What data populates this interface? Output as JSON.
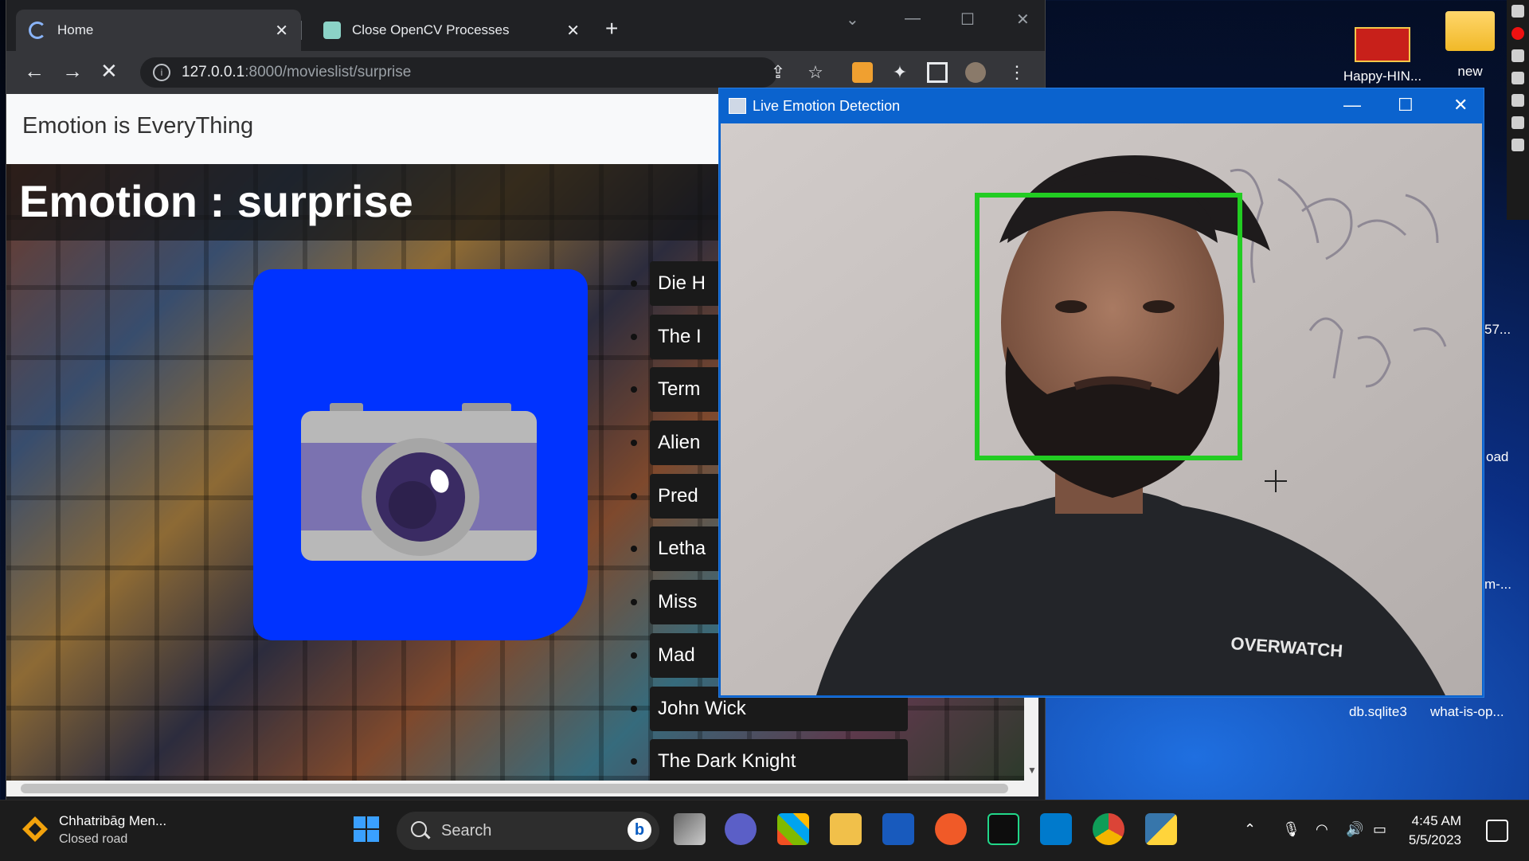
{
  "browser": {
    "tabs": [
      {
        "label": "Home"
      },
      {
        "label": "Close OpenCV Processes"
      }
    ],
    "url": {
      "host": "127.0.0.1",
      "path": ":8000/movieslist/surprise"
    }
  },
  "site": {
    "brand": "Emotion is EveryThing",
    "emotion_title": "Emotion : surprise",
    "movies": [
      "Die H",
      "The I",
      "Term",
      "Alien",
      "Pred",
      "Letha",
      "Miss",
      "Mad",
      "John Wick",
      "The Dark Knight"
    ]
  },
  "cv_window": {
    "title": "Live Emotion Detection",
    "shirt_text": "OVERWATCH"
  },
  "desktop": {
    "icons": [
      {
        "label": "Happy-HIN..."
      },
      {
        "label": "new"
      },
      {
        "label": "db.sqlite3"
      },
      {
        "label": "what-is-op..."
      }
    ],
    "partial_labels": [
      "57...",
      "oad",
      "m-..."
    ]
  },
  "taskbar": {
    "weather_title": "Chhatribāg Men...",
    "weather_sub": "Closed road",
    "search_placeholder": "Search",
    "time": "4:45 AM",
    "date": "5/5/2023"
  },
  "colors": {
    "camera_card": "#0033ff",
    "face_box": "#22cc22",
    "cv_titlebar": "#0b63ce"
  }
}
